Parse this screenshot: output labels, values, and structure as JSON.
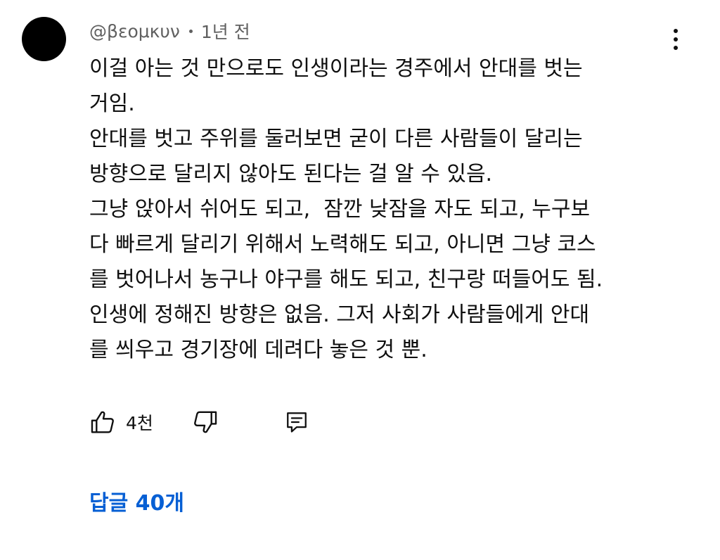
{
  "comment": {
    "author": "@βεομκυν",
    "time_ago": "1년 전",
    "text_lines": [
      "이걸 아는 것 만으로도 인생이라는 경주에서 안대를 벗는",
      "거임.",
      "안대를 벗고 주위를 둘러보면 굳이 다른 사람들이 달리는",
      "방향으로 달리지 않아도 된다는 걸 알 수 있음.",
      "그냥 앉아서 쉬어도 되고,  잠깐 낮잠을 자도 되고, 누구보",
      "다 빠르게 달리기 위해서 노력해도 되고, 아니면 그냥 코스",
      "를 벗어나서 농구나 야구를 해도 되고, 친구랑 떠들어도 됨.",
      "인생에 정해진 방향은 없음. 그저 사회가 사람들에게 안대",
      "를 씌우고 경기장에 데려다 놓은 것 뿐."
    ]
  },
  "actions": {
    "like_icon": "thumbs-up-icon",
    "like_count": "4천",
    "dislike_icon": "thumbs-down-icon",
    "reply_icon": "comment-icon"
  },
  "menu_icon": "more-vertical-icon",
  "replies": {
    "label": "답글 40개",
    "color": "#065fd4"
  }
}
